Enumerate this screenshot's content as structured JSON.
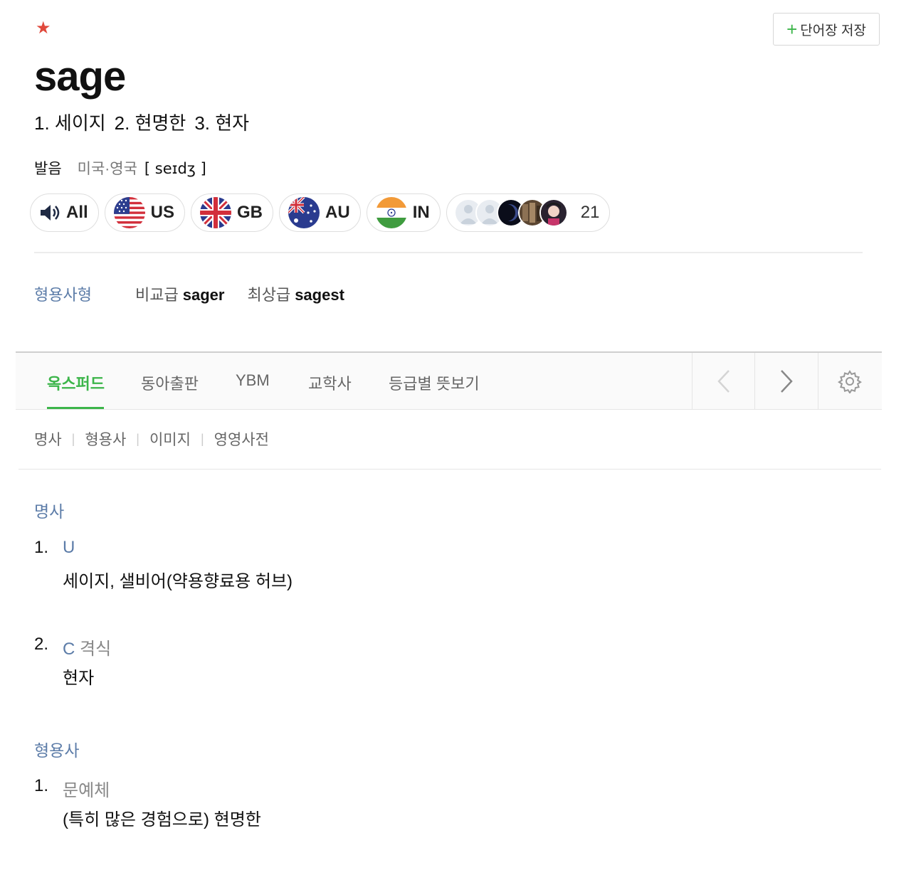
{
  "header": {
    "star_icon": "star-icon",
    "save_button_label": "단어장 저장",
    "word": "sage",
    "summary": [
      "1. 세이지",
      "2. 현명한",
      "3. 현자"
    ]
  },
  "pronunciation": {
    "label": "발음",
    "region": "미국·영국",
    "ipa": "[ seɪdʒ ]",
    "buttons": [
      {
        "label": "All",
        "icon": "speaker-icon"
      },
      {
        "label": "US",
        "icon": "us-flag-icon"
      },
      {
        "label": "GB",
        "icon": "gb-flag-icon"
      },
      {
        "label": "AU",
        "icon": "au-flag-icon"
      },
      {
        "label": "IN",
        "icon": "in-flag-icon"
      }
    ],
    "user_recordings_count": "21"
  },
  "forms": {
    "label": "형용사형",
    "comparative_label": "비교급",
    "comparative": "sager",
    "superlative_label": "최상급",
    "superlative": "sagest"
  },
  "tabs": [
    "옥스퍼드",
    "동아출판",
    "YBM",
    "교학사",
    "등급별 뜻보기"
  ],
  "active_tab": "옥스퍼드",
  "subnav": [
    "명사",
    "형용사",
    "이미지",
    "영영사전"
  ],
  "entries": [
    {
      "pos": "명사",
      "senses": [
        {
          "num": "1.",
          "grammar": "U",
          "register": "",
          "meaning": "세이지, 샐비어(약용향료용 허브)"
        },
        {
          "num": "2.",
          "grammar": "C",
          "register": "격식",
          "meaning": "현자"
        }
      ]
    },
    {
      "pos": "형용사",
      "senses": [
        {
          "num": "1.",
          "grammar": "",
          "register": "문예체",
          "meaning": "(특히 많은 경험으로) 현명한"
        }
      ]
    }
  ],
  "colors": {
    "accent_green": "#3cb54a",
    "label_blue": "#5c7ca8",
    "star_red": "#e0493c"
  }
}
